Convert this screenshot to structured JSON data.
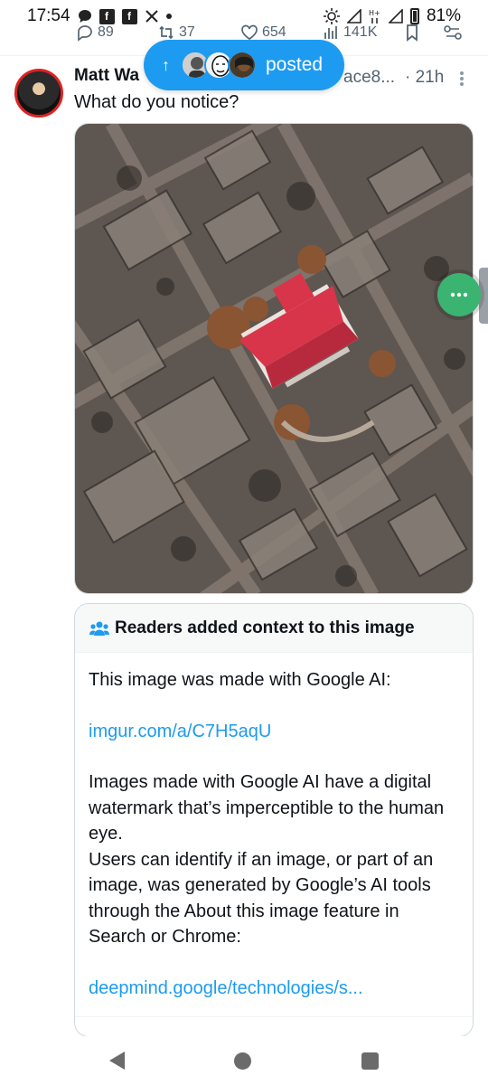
{
  "status_bar": {
    "time": "17:54",
    "battery": "81%",
    "left_icons": [
      "chat-bubble-icon",
      "facebook-icon",
      "facebook-icon",
      "x-icon",
      "dot-icon"
    ],
    "right_icons": [
      "brightness-icon",
      "signal-icon",
      "hplus-icon",
      "signal-icon",
      "battery-icon"
    ]
  },
  "prev_post_actions": {
    "replies": "89",
    "reposts": "37",
    "likes": "654",
    "views": "141K"
  },
  "posted_pill": {
    "label": "posted"
  },
  "post": {
    "author": "Matt Wa",
    "handle": "ace8...",
    "time": "· 21h",
    "text": "What do you notice?"
  },
  "community_note": {
    "title": "Readers added context to this image",
    "paragraph1": "This image was made with Google AI:",
    "link1": "imgur.com/a/C7H5aqU",
    "paragraph2": "Images made with Google AI have a digital watermark that’s imperceptible to the human eye.",
    "paragraph3": "Users can identify if an image, or part of an image, was generated by Google’s AI tools through the About this image feature in Search or Chrome:",
    "link2": "deepmind.google/technologies/s..."
  },
  "colors": {
    "accent": "#1d9bf0",
    "roof": "#d8354a",
    "bubble": "#3bb371"
  }
}
